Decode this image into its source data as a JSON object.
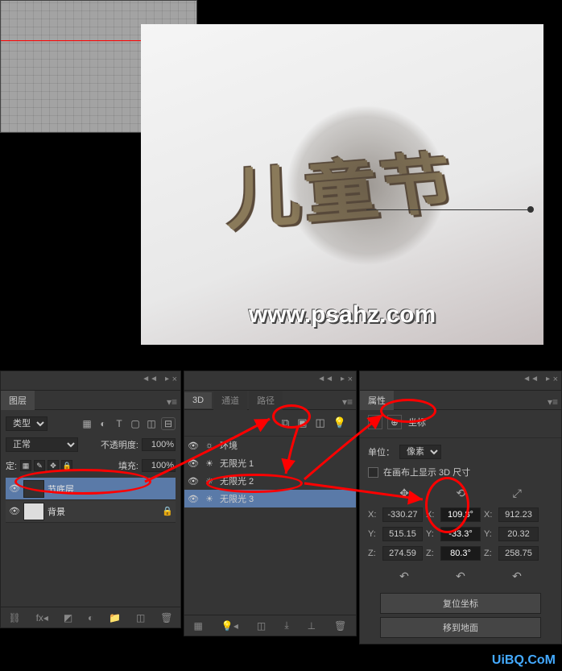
{
  "canvas": {
    "render_chars": "儿童节",
    "watermark": "www.psahz.com"
  },
  "layers_panel": {
    "tab": "图层",
    "kind_label": "类型",
    "blend_mode": "正常",
    "opacity_label": "不透明度:",
    "opacity_value": "100%",
    "lock_label": "定:",
    "fill_label": "填充:",
    "fill_value": "100%",
    "layers": [
      {
        "name": "节底层",
        "selected": true,
        "locked": false
      },
      {
        "name": "背景",
        "selected": false,
        "locked": true
      }
    ]
  },
  "panel_3d": {
    "tabs": [
      "3D",
      "通道",
      "路径"
    ],
    "items": [
      {
        "name": "环境",
        "icon": "☼",
        "selected": false
      },
      {
        "name": "无限光 1",
        "icon": "☀",
        "selected": false
      },
      {
        "name": "无限光 2",
        "icon": "☀",
        "selected": false
      },
      {
        "name": "无限光 3",
        "icon": "☀",
        "selected": true
      }
    ]
  },
  "props_panel": {
    "tab": "属性",
    "mode_label": "坐标",
    "unit_label": "单位：",
    "unit_value": "像素",
    "show_3d_size": "在画布上显示 3D 尺寸",
    "coords": {
      "x": {
        "pos": "-330.27",
        "rot": "109.8°",
        "scale": "912.23"
      },
      "y": {
        "pos": "515.15",
        "rot": "-33.3°",
        "scale": "20.32"
      },
      "z": {
        "pos": "274.59",
        "rot": "80.3°",
        "scale": "258.75"
      }
    },
    "reset_btn": "复位坐标",
    "ground_btn": "移到地面"
  },
  "footer_logo": "UiBQ.CoM"
}
